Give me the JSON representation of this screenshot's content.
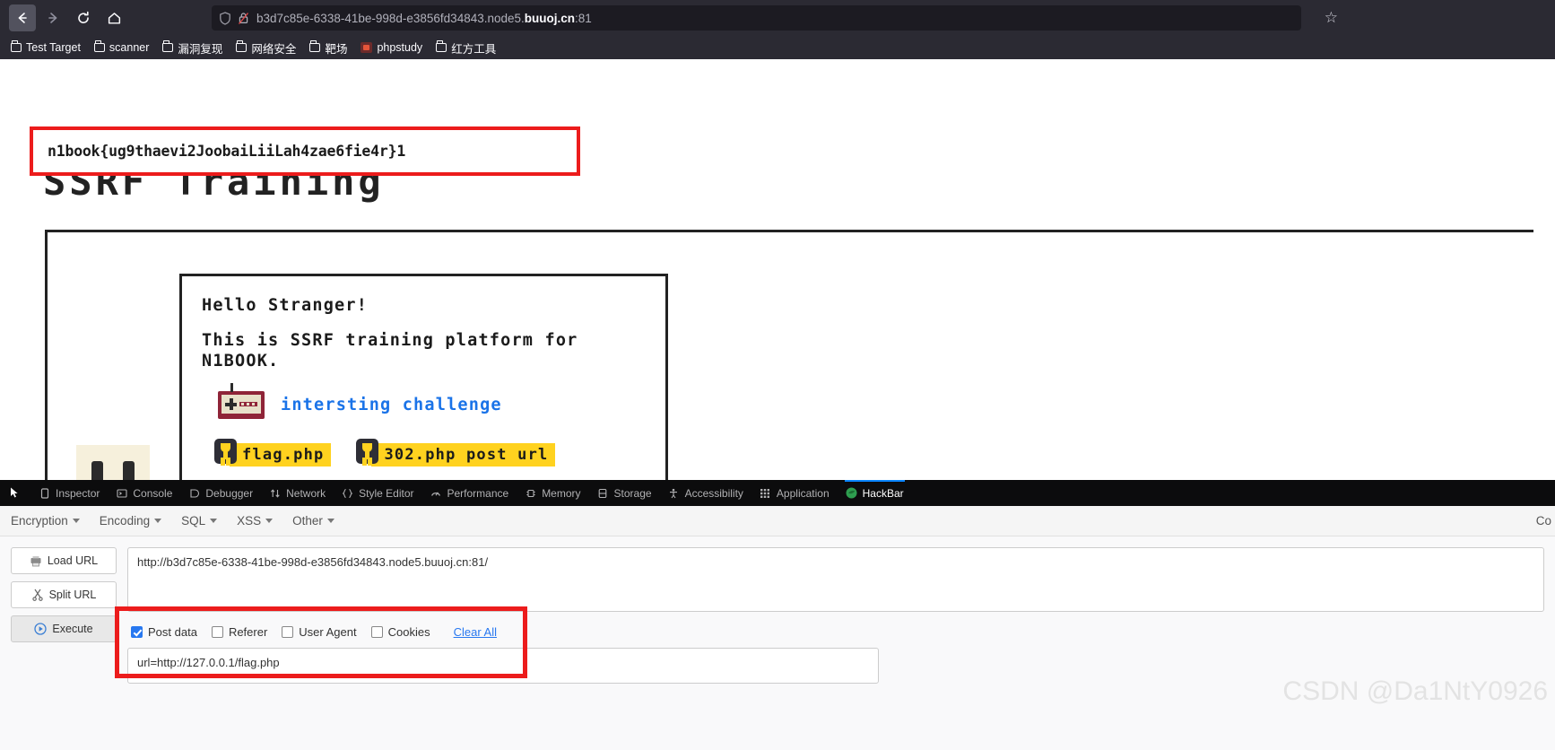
{
  "browser": {
    "back_icon": "back-arrow",
    "forward_icon": "forward-arrow",
    "reload_icon": "reload",
    "home_icon": "home",
    "url": "b3d7c85e-6338-41be-998d-e3856fd34843.node5.",
    "url_domain": "buuoj.cn",
    "url_port": ":81",
    "bookmark_star": "☆",
    "bookmarks": [
      {
        "label": "Test Target",
        "icon": "folder-icon"
      },
      {
        "label": "scanner",
        "icon": "folder-icon"
      },
      {
        "label": "漏洞复现",
        "icon": "folder-icon"
      },
      {
        "label": "网络安全",
        "icon": "folder-icon"
      },
      {
        "label": "靶场",
        "icon": "folder-icon"
      },
      {
        "label": "phpstudy",
        "icon": "phpstudy-icon"
      },
      {
        "label": "红方工具",
        "icon": "folder-icon"
      }
    ]
  },
  "page": {
    "flag": "n1book{ug9thaevi2JoobaiLiiLah4zae6fie4r}1",
    "heading": "SSRF Training",
    "greeting": "Hello Stranger!",
    "description": "This is SSRF training platform for N1BOOK.",
    "challenge_link": "intersting challenge",
    "links": [
      {
        "label": "flag.php",
        "icon": "trophy-icon"
      },
      {
        "label": "302.php post url",
        "icon": "trophy-icon"
      }
    ],
    "colors": {
      "flag_box_border": "#ec1c1c",
      "link_blue": "#1a73e8",
      "highlight": "#ffd21f"
    }
  },
  "devtools": {
    "picker_icon": "element-picker-icon",
    "tabs": [
      {
        "label": "Inspector",
        "icon": "inspector-icon",
        "active": false
      },
      {
        "label": "Console",
        "icon": "console-icon",
        "active": false
      },
      {
        "label": "Debugger",
        "icon": "debugger-icon",
        "active": false
      },
      {
        "label": "Network",
        "icon": "network-icon",
        "active": false
      },
      {
        "label": "Style Editor",
        "icon": "style-editor-icon",
        "active": false
      },
      {
        "label": "Performance",
        "icon": "performance-icon",
        "active": false
      },
      {
        "label": "Memory",
        "icon": "memory-icon",
        "active": false
      },
      {
        "label": "Storage",
        "icon": "storage-icon",
        "active": false
      },
      {
        "label": "Accessibility",
        "icon": "accessibility-icon",
        "active": false
      },
      {
        "label": "Application",
        "icon": "application-icon",
        "active": false
      },
      {
        "label": "HackBar",
        "icon": "hackbar-icon",
        "active": true
      }
    ]
  },
  "hackbar": {
    "menus": [
      {
        "label": "Encryption"
      },
      {
        "label": "Encoding"
      },
      {
        "label": "SQL"
      },
      {
        "label": "XSS"
      },
      {
        "label": "Other"
      }
    ],
    "corner_label": "Co",
    "buttons": [
      {
        "label": "Load URL",
        "icon": "load-url-icon"
      },
      {
        "label": "Split URL",
        "icon": "split-url-icon"
      },
      {
        "label": "Execute",
        "icon": "execute-icon"
      }
    ],
    "url_value": "http://b3d7c85e-6338-41be-998d-e3856fd34843.node5.buuoj.cn:81/",
    "checkboxes": [
      {
        "label": "Post data",
        "checked": true
      },
      {
        "label": "Referer",
        "checked": false
      },
      {
        "label": "User Agent",
        "checked": false
      },
      {
        "label": "Cookies",
        "checked": false
      }
    ],
    "clear_all": "Clear All",
    "post_data_value": "url=http://127.0.0.1/flag.php"
  },
  "watermark": "CSDN @Da1NtY0926"
}
